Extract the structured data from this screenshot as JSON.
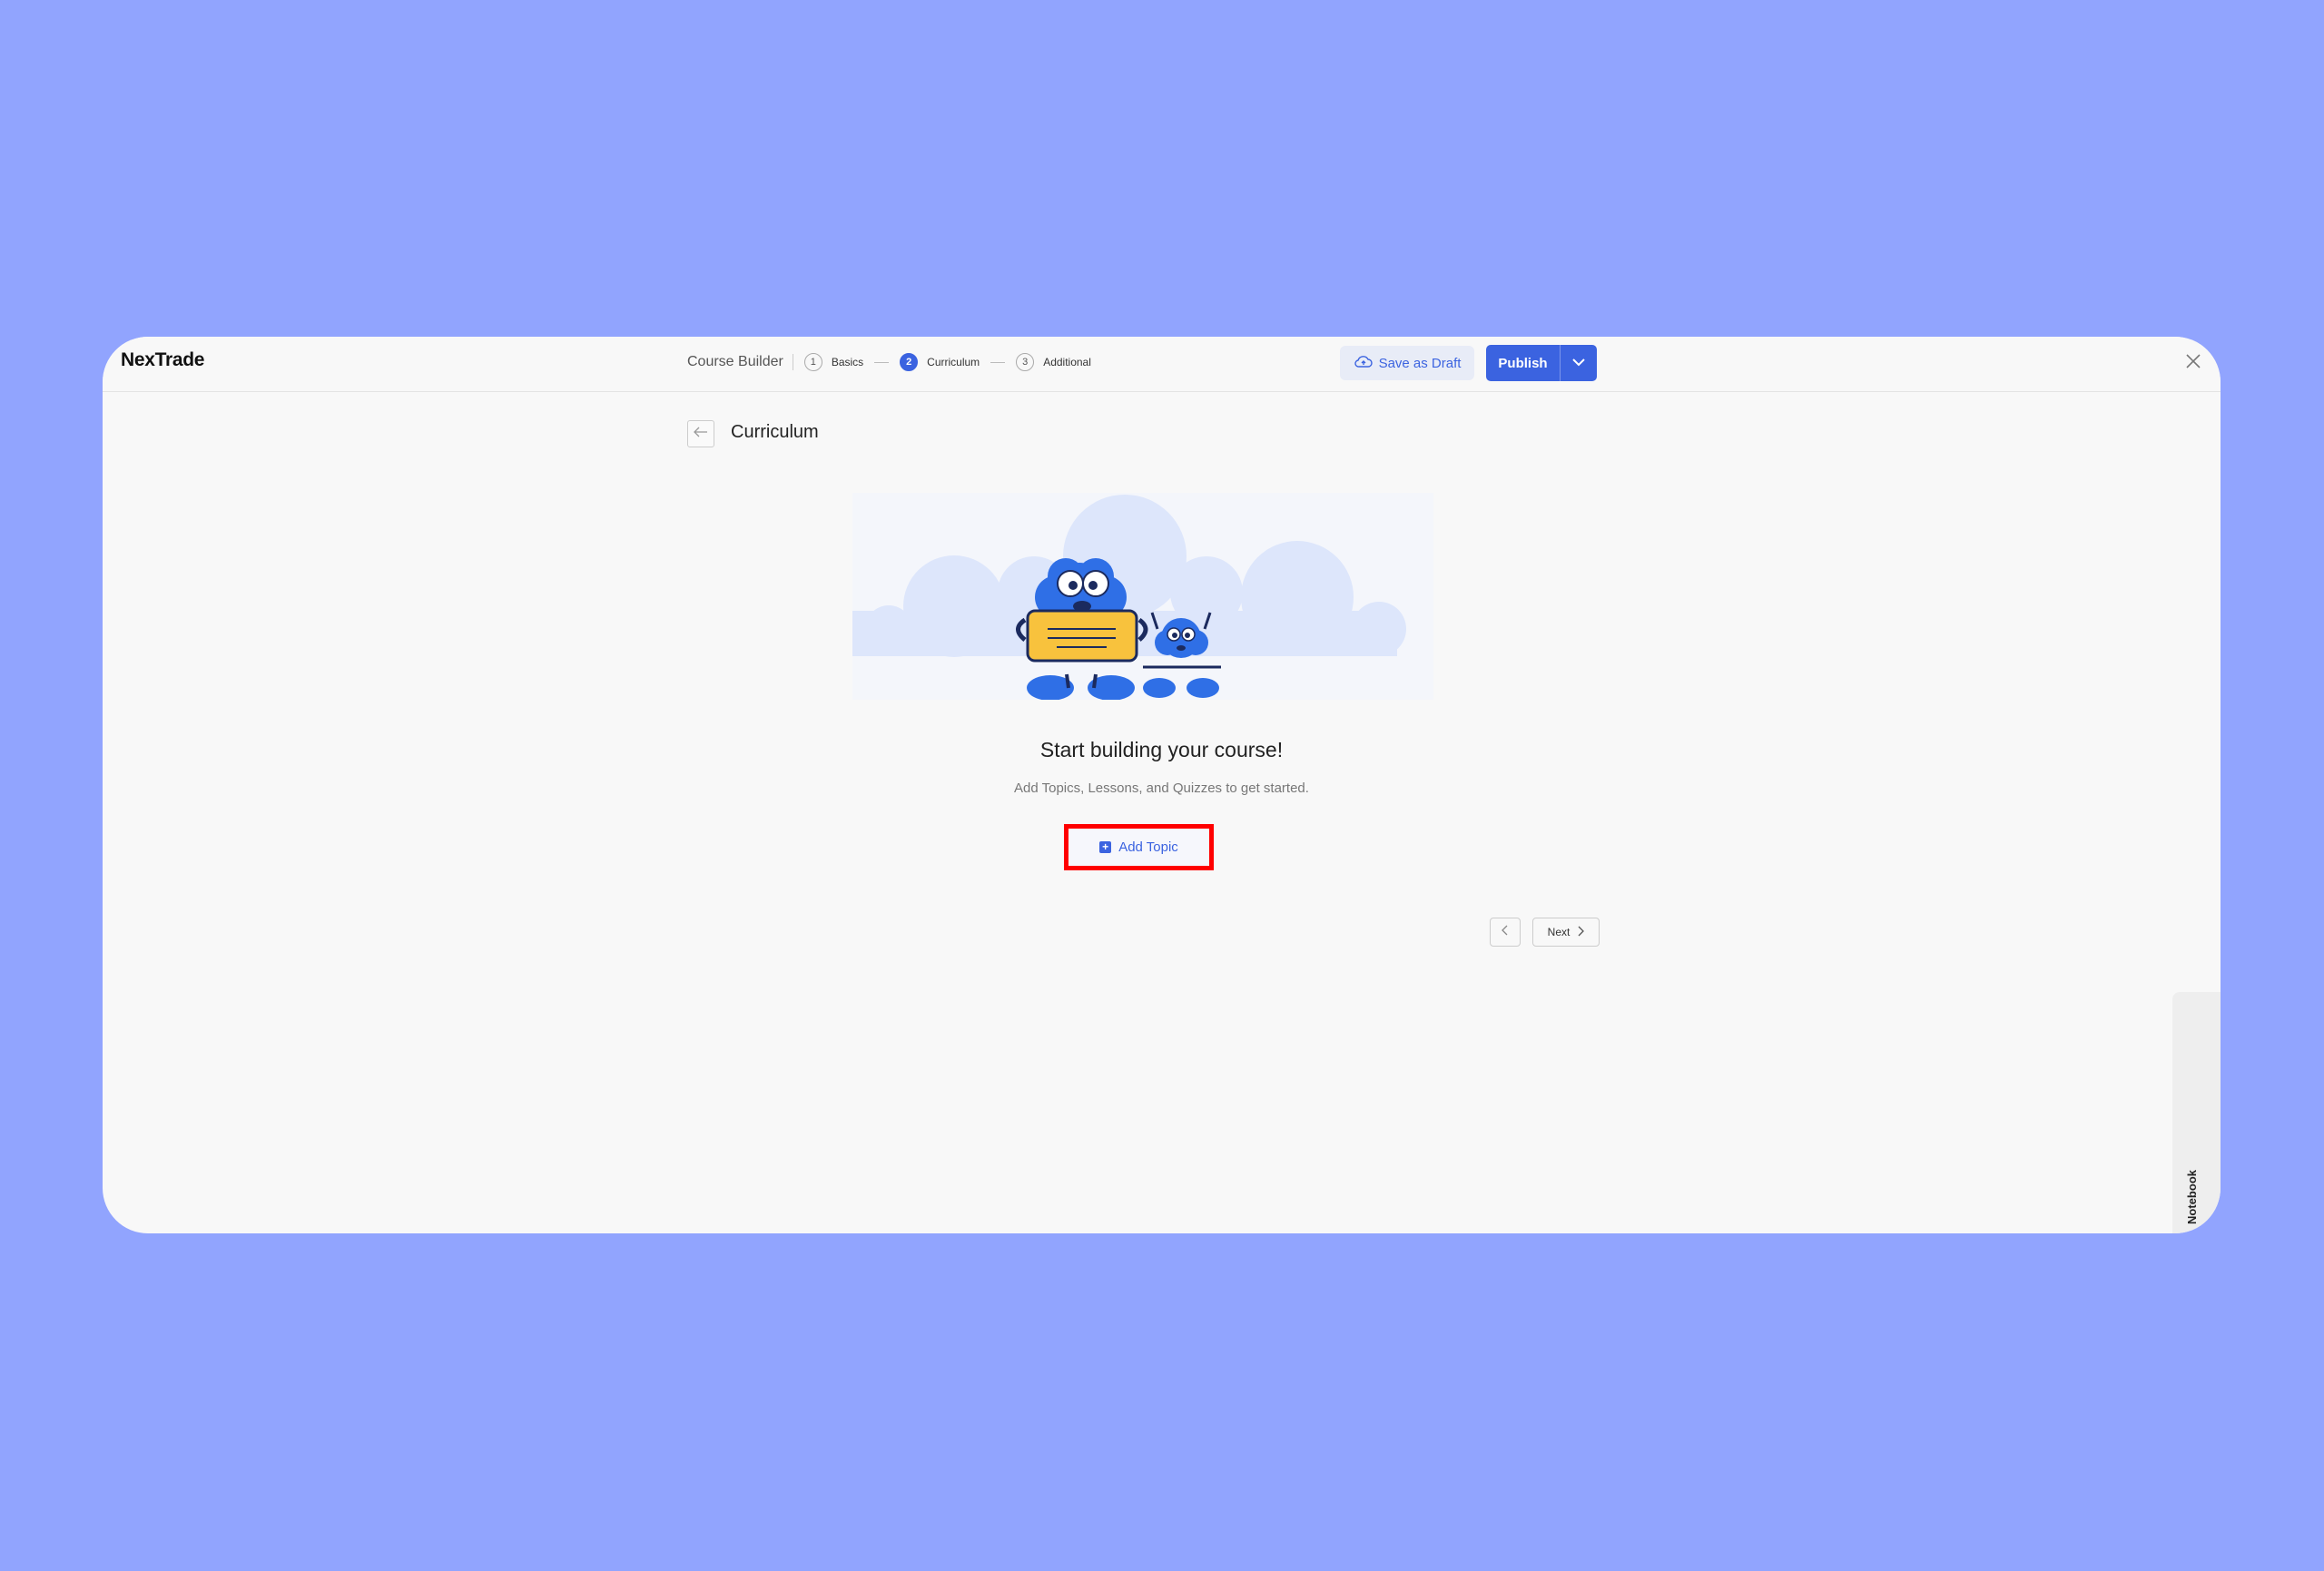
{
  "app": {
    "logo_text": "NexTrade"
  },
  "header": {
    "builder_title": "Course Builder",
    "steps": [
      {
        "num": "1",
        "label": "Basics"
      },
      {
        "num": "2",
        "label": "Curriculum"
      },
      {
        "num": "3",
        "label": "Additional"
      }
    ],
    "save_draft_label": "Save as Draft",
    "publish_label": "Publish"
  },
  "main": {
    "page_title": "Curriculum",
    "heading": "Start building your course!",
    "subheading": "Add Topics, Lessons, and Quizzes to get started.",
    "add_topic_label": "Add Topic",
    "next_label": "Next"
  },
  "sidebar": {
    "notebook_label": "Notebook"
  },
  "colors": {
    "background": "#91a4fe",
    "accent": "#3b63e0",
    "highlight": "#ff0000"
  }
}
